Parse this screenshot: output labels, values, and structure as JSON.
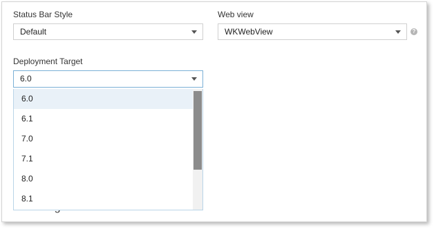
{
  "fields": {
    "status_bar_style": {
      "label": "Status Bar Style",
      "value": "Default"
    },
    "web_view": {
      "label": "Web view",
      "value": "WKWebView",
      "help": "?"
    },
    "deployment_target": {
      "label": "Deployment Target",
      "value": "6.0"
    }
  },
  "dropdown": {
    "options": [
      "6.0",
      "6.1",
      "7.0",
      "7.1",
      "8.0",
      "8.1"
    ],
    "selected_index": 0
  },
  "obscured_heading": "Background Mode",
  "icons": {
    "caret": "chevron-down-icon",
    "help": "help-circle-icon"
  },
  "colors": {
    "focus_border": "#7ab0d6",
    "option_highlight": "#e9f1f8",
    "scroll_thumb": "#8c8c8c"
  }
}
